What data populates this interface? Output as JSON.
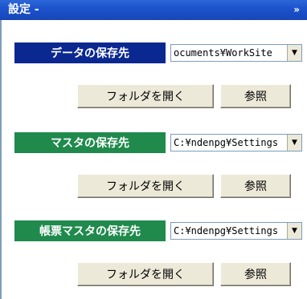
{
  "window": {
    "title": "設定 -",
    "collapse_glyph": "»"
  },
  "sections": [
    {
      "label": "データの保存先",
      "path_display": "ocuments¥WorkSite",
      "open_folder_label": "フォルダを開く",
      "browse_label": "参照"
    },
    {
      "label": "マスタの保存先",
      "path_display": "C:¥ndenpg¥Settings",
      "open_folder_label": "フォルダを開く",
      "browse_label": "参照"
    },
    {
      "label": "帳票マスタの保存先",
      "path_display": "C:¥ndenpg¥Settings",
      "open_folder_label": "フォルダを開く",
      "browse_label": "参照"
    }
  ],
  "colors": {
    "section1_label_bg": "#0b2891",
    "section2_label_bg": "#1f8a4c",
    "section3_label_bg": "#1f8a4c"
  }
}
